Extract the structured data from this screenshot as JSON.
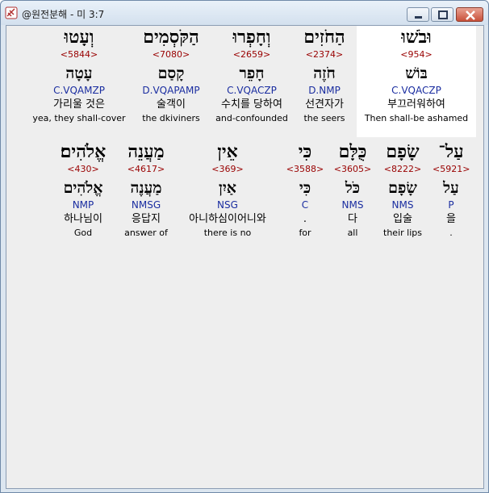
{
  "window": {
    "title": "@원전분해 - 미 3:7",
    "colors": {
      "strong": "#990000",
      "morph": "#1a2da0",
      "highlight": "#ffffff"
    }
  },
  "verse": {
    "row1": [
      {
        "heb": "וּבֹשׁוּ",
        "strong": "<954>",
        "lemma": "בּוֹשׁ",
        "morph": "C.VQACZP",
        "korean": "부끄러워하여",
        "english": "Then shall-be ashamed"
      },
      {
        "heb": "הַחֹזִים",
        "strong": "<2374>",
        "lemma": "חֹזֶה",
        "morph": "D.NMP",
        "korean": "선견자가",
        "english": "the seers"
      },
      {
        "heb": "וְחָפְרוּ",
        "strong": "<2659>",
        "lemma": "חָפֵר",
        "morph": "C.VQACZP",
        "korean": "수치를 당하여",
        "english": "and-confounded"
      },
      {
        "heb": "הַקֹּסְמִים",
        "strong": "<7080>",
        "lemma": "קָסַם",
        "morph": "D.VQAPAMP",
        "korean": "술객이",
        "english": "the dkiviners"
      },
      {
        "heb": "וְעָטוּ",
        "strong": "<5844>",
        "lemma": "עָטָה",
        "morph": "C.VQAMZP",
        "korean": "가리울 것은",
        "english": "yea, they shall-cover"
      }
    ],
    "row2": [
      {
        "heb": "עַל־",
        "strong": "<5921>",
        "lemma": "עַל",
        "morph": "P",
        "korean": "을",
        "english": "."
      },
      {
        "heb": "שָׂפָם",
        "strong": "<8222>",
        "lemma": "שָׂפָם",
        "morph": "NMS",
        "korean": "입술",
        "english": "their lips"
      },
      {
        "heb": "כֻּלָּם",
        "strong": "<3605>",
        "lemma": "כֹּל",
        "morph": "NMS",
        "korean": "다",
        "english": "all"
      },
      {
        "heb": "כִּי",
        "strong": "<3588>",
        "lemma": "כִּי",
        "morph": "C",
        "korean": ".",
        "english": "for"
      },
      {
        "heb": "אֵין",
        "strong": "<369>",
        "lemma": "אַיִן",
        "morph": "NSG",
        "korean": "아니하심이어니와",
        "english": "there is no"
      },
      {
        "heb": "מַעֲנֵה",
        "strong": "<4617>",
        "lemma": "מַעֲנֶה",
        "morph": "NMSG",
        "korean": "응답지",
        "english": "answer of"
      },
      {
        "heb": "אֱלֹהִים׃",
        "strong": "<430>",
        "lemma": "אֱלֹהִים",
        "morph": "NMP",
        "korean": "하나님이",
        "english": "God"
      }
    ]
  }
}
